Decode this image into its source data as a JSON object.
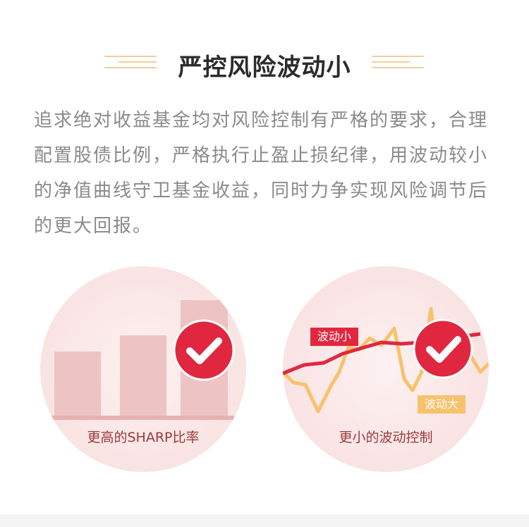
{
  "header": {
    "title": "严控风险波动小",
    "decoration_color": "#f0cf9f"
  },
  "description": "追求绝对收益基金均对风险控制有严格的要求，合理配置股债比例，严格执行止盈止损纪律，用波动较小的净值曲线守卫基金收益，同时力争实现风险调节后的更大回报。",
  "panels": {
    "left": {
      "label": "更高的SHARP比率",
      "icon": "check-badge-icon"
    },
    "right": {
      "label": "更小的波动控制",
      "icon": "check-badge-icon",
      "tag_small": "波动小",
      "tag_big": "波动大"
    }
  },
  "colors": {
    "accent_red": "#e12740",
    "soft_pink": "#f8e4e4",
    "bar_pink": "#eec3c3",
    "volatile_orange": "#f7c26d",
    "text_gray": "#8a8a8a",
    "title_dark": "#2b2b2b"
  }
}
